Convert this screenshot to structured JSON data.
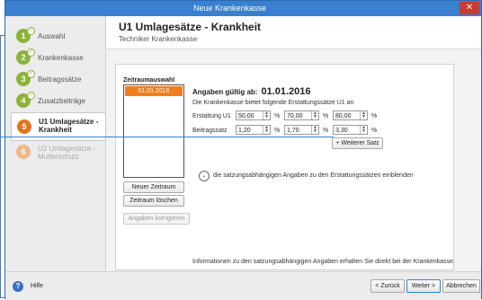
{
  "window": {
    "title": "Neue Krankenkasse",
    "close_glyph": "✕"
  },
  "steps": [
    {
      "num": "1",
      "label": "Auswahl",
      "state": "done"
    },
    {
      "num": "2",
      "label": "Krankenkasse",
      "state": "done"
    },
    {
      "num": "3",
      "label": "Beitragssätze",
      "state": "done"
    },
    {
      "num": "4",
      "label": "Zusatzbeiträge",
      "state": "done"
    },
    {
      "num": "5",
      "label": "U1 Umlagesätze - Krankheit",
      "label_line1": "U1 Umlagesätze -",
      "label_line2": "Krankheit",
      "state": "active"
    },
    {
      "num": "6",
      "label": "U2 Umlagesätze - Mutterschutz",
      "label_line1": "U2 Umlagesätze -",
      "label_line2": "Mutterschutz",
      "state": "future"
    }
  ],
  "header": {
    "title": "U1 Umlagesätze - Krankheit",
    "subtitle": "Techniker Krankenkasse"
  },
  "period": {
    "label": "Zeitraumauswahl",
    "items": [
      "01.01.2016"
    ],
    "new_button": "Neuer Zeitraum",
    "delete_button": "Zeitraum löschen",
    "correct_button": "Angaben korrigieren"
  },
  "details": {
    "valid_label": "Angaben gültig ab:",
    "valid_date": "01.01.2016",
    "info": "Die Krankenkasse bietet folgende Erstattungssätze U1 an",
    "rows": [
      {
        "label": "Erstattung U1",
        "values": [
          "50,00",
          "70,00",
          "80,00"
        ]
      },
      {
        "label": "Beitragssatz",
        "values": [
          "1,20",
          "1,70",
          "3,30"
        ]
      }
    ],
    "unit": "%",
    "add_rate_button": "+ Weiterer Satz",
    "expand_text": "die satzungsabhängigen Angaben zu den Erstattungssätzen einblenden",
    "footnote": "Informationen zu den satzungsabhängigen Angaben erhalten Sie direkt bei der Krankenkasse."
  },
  "footer": {
    "help_label": "Hilfe",
    "help_glyph": "?",
    "back_button": "< Zurück",
    "next_button": "Weiter >",
    "cancel_button": "Abbrechen"
  },
  "colors": {
    "accent": "#3a7fd0",
    "done": "#8cb23a",
    "active": "#e0761e",
    "future": "#f0b88a",
    "selection": "#f07e1e",
    "close": "#c83b2f"
  }
}
